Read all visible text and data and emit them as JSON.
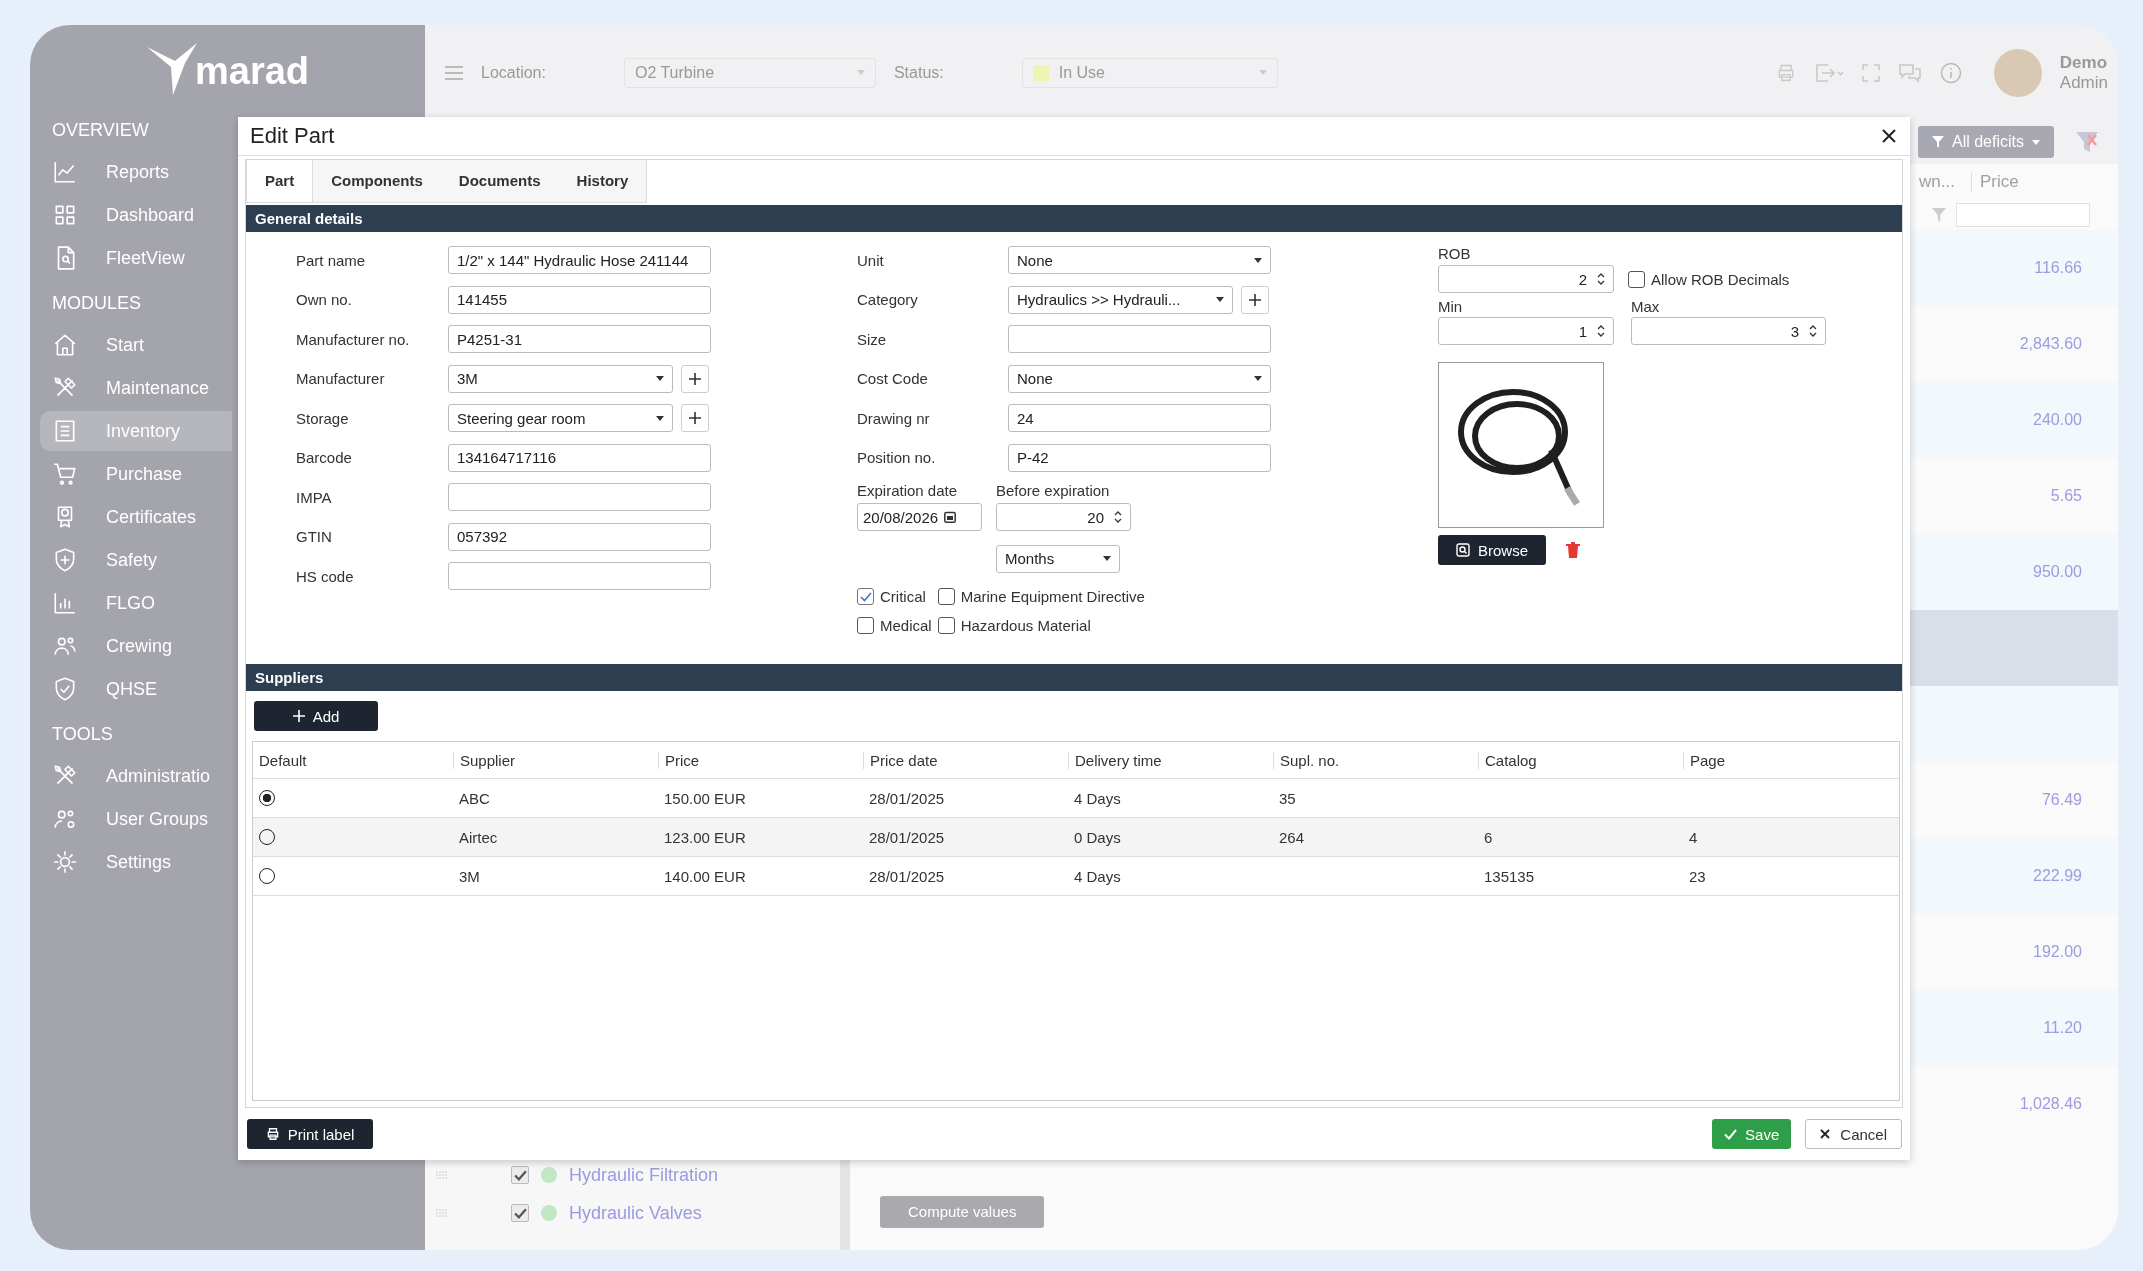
{
  "sidebar": {
    "logo": "marad",
    "sections": [
      {
        "title": "OVERVIEW",
        "items": [
          {
            "label": "Reports",
            "selected": false
          },
          {
            "label": "Dashboard",
            "selected": false
          },
          {
            "label": "FleetView",
            "selected": false
          }
        ]
      },
      {
        "title": "MODULES",
        "items": [
          {
            "label": "Start",
            "selected": false
          },
          {
            "label": "Maintenance",
            "selected": false
          },
          {
            "label": "Inventory",
            "selected": true
          },
          {
            "label": "Purchase",
            "selected": false
          },
          {
            "label": "Certificates",
            "selected": false
          },
          {
            "label": "Safety",
            "selected": false
          },
          {
            "label": "FLGO",
            "selected": false
          },
          {
            "label": "Crewing",
            "selected": false
          },
          {
            "label": "QHSE",
            "selected": false
          }
        ]
      },
      {
        "title": "TOOLS",
        "items": [
          {
            "label": "Administratio",
            "selected": false
          },
          {
            "label": "User Groups",
            "selected": false
          },
          {
            "label": "Settings",
            "selected": false
          }
        ]
      }
    ]
  },
  "topbar": {
    "location_label": "Location:",
    "location": "O2 Turbine",
    "status_label": "Status:",
    "status": "In Use",
    "user_name": "Demo",
    "user_role": "Admin"
  },
  "background": {
    "filter_button": "All deficits",
    "columns": [
      "wn...",
      "Price"
    ],
    "rows": [
      {
        "price": "116.66",
        "selected": false
      },
      {
        "price": "2,843.60",
        "selected": false
      },
      {
        "price": "240.00",
        "selected": false
      },
      {
        "price": "5.65",
        "selected": false
      },
      {
        "price": "950.00",
        "selected": false
      },
      {
        "selected": true
      },
      {
        "selected": false
      },
      {
        "price": "76.49",
        "selected": false
      },
      {
        "price": "222.99",
        "selected": false
      },
      {
        "price": "192.00",
        "selected": false
      },
      {
        "price": "11.20",
        "selected": false
      },
      {
        "price": "1,028.46",
        "selected": false
      }
    ],
    "tree_items": [
      {
        "label": "Hydraulic Filtration",
        "checked": true
      },
      {
        "label": "Hydraulic Valves",
        "checked": true
      }
    ],
    "compute_button": "Compute values"
  },
  "dialog": {
    "title": "Edit Part",
    "tabs": [
      {
        "label": "Part",
        "selected": true
      },
      {
        "label": "Components",
        "selected": false
      },
      {
        "label": "Documents",
        "selected": false
      },
      {
        "label": "History",
        "selected": false
      }
    ],
    "general_title": "General details",
    "left_fields": [
      {
        "label": "Part name",
        "kind": "text",
        "value": "1/2\" x 144\" Hydraulic Hose 241144"
      },
      {
        "label": "Own no.",
        "kind": "text",
        "value": "141455"
      },
      {
        "label": "Manufacturer no.",
        "kind": "text",
        "value": "P4251-31"
      },
      {
        "label": "Manufacturer",
        "kind": "select_add",
        "value": "3M"
      },
      {
        "label": "Storage",
        "kind": "select_add",
        "value": "Steering gear room"
      },
      {
        "label": "Barcode",
        "kind": "text",
        "value": "134164717116"
      },
      {
        "label": "IMPA",
        "kind": "text"
      },
      {
        "label": "GTIN",
        "kind": "text",
        "value": "057392"
      },
      {
        "label": "HS code",
        "kind": "text"
      }
    ],
    "mid_fields": [
      {
        "label": "Unit",
        "kind": "select",
        "value": "None"
      },
      {
        "label": "Category",
        "kind": "select_add",
        "value": "Hydraulics >> Hydrauli..."
      },
      {
        "label": "Size",
        "kind": "text"
      },
      {
        "label": "Cost Code",
        "kind": "select",
        "value": "None"
      },
      {
        "label": "Drawing nr",
        "kind": "text",
        "value": "24"
      },
      {
        "label": "Position no.",
        "kind": "text",
        "value": "P-42"
      }
    ],
    "expiration": {
      "date_label": "Expiration date",
      "date": "20/08/2026",
      "before_label": "Before expiration",
      "before": "20",
      "unit": "Months"
    },
    "flags": [
      {
        "label": "Critical",
        "checked": true
      },
      {
        "label": "Marine Equipment Directive",
        "checked": false
      },
      {
        "label": "Medical",
        "checked": false
      },
      {
        "label": "Hazardous Material",
        "checked": false
      }
    ],
    "rob": {
      "label": "ROB",
      "value": "2",
      "decimals_label": "Allow ROB Decimals",
      "decimals": false,
      "min_label": "Min",
      "min": "1",
      "max_label": "Max",
      "max": "3"
    },
    "browse": "Browse",
    "suppliers": {
      "title": "Suppliers",
      "add": "Add",
      "columns": [
        "Default",
        "Supplier",
        "Price",
        "Price date",
        "Delivery time",
        "Supl. no.",
        "Catalog",
        "Page"
      ],
      "rows": [
        {
          "default": true,
          "supplier": "ABC",
          "price": "150.00 EUR",
          "price_date": "28/01/2025",
          "delivery_time": "4 Days",
          "supl_no": "35"
        },
        {
          "default": false,
          "supplier": "Airtec",
          "price": "123.00 EUR",
          "price_date": "28/01/2025",
          "delivery_time": "0 Days",
          "supl_no": "264",
          "catalog": "6",
          "page": "4"
        },
        {
          "default": false,
          "supplier": "3M",
          "price": "140.00 EUR",
          "price_date": "28/01/2025",
          "delivery_time": "4 Days",
          "catalog": "135135",
          "page": "23"
        }
      ]
    },
    "print_label": "Print label",
    "save": "Save",
    "cancel": "Cancel"
  }
}
